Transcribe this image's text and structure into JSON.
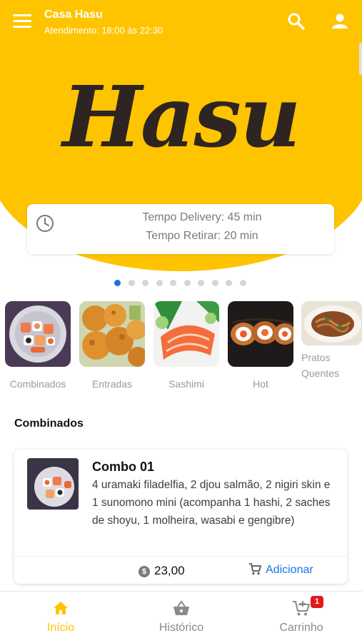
{
  "header": {
    "store_name": "Casa Hasu",
    "hours": "Atendimento: 18:00 às 22:30",
    "logo_text": "Hasu"
  },
  "delivery": {
    "delivery_time": "Tempo Delivery: 45 min",
    "pickup_time": "Tempo Retirar: 20 min"
  },
  "carousel": {
    "total": 10,
    "active_index": 0
  },
  "categories": [
    {
      "label": "Combinados"
    },
    {
      "label": "Entradas"
    },
    {
      "label": "Sashimi"
    },
    {
      "label": "Hot"
    },
    {
      "label": "Pratos Quentes"
    }
  ],
  "section": {
    "title": "Combinados"
  },
  "product": {
    "name": "Combo 01",
    "description": "4 uramaki filadelfia, 2 djou salmão, 2 nigiri skin e 1 sunomono mini (acompanha 1 hashi, 2 saches de shoyu, 1 molheira, wasabi e gengibre)",
    "price": "23,00",
    "add_label": "Adicionar"
  },
  "bottom_nav": [
    {
      "label": "Início",
      "active": true
    },
    {
      "label": "Histórico",
      "active": false
    },
    {
      "label": "Carrinho",
      "active": false,
      "badge": "1"
    }
  ],
  "colors": {
    "brand_yellow": "#FFC400",
    "accent_blue": "#1a73e8",
    "badge_red": "#e01919"
  }
}
